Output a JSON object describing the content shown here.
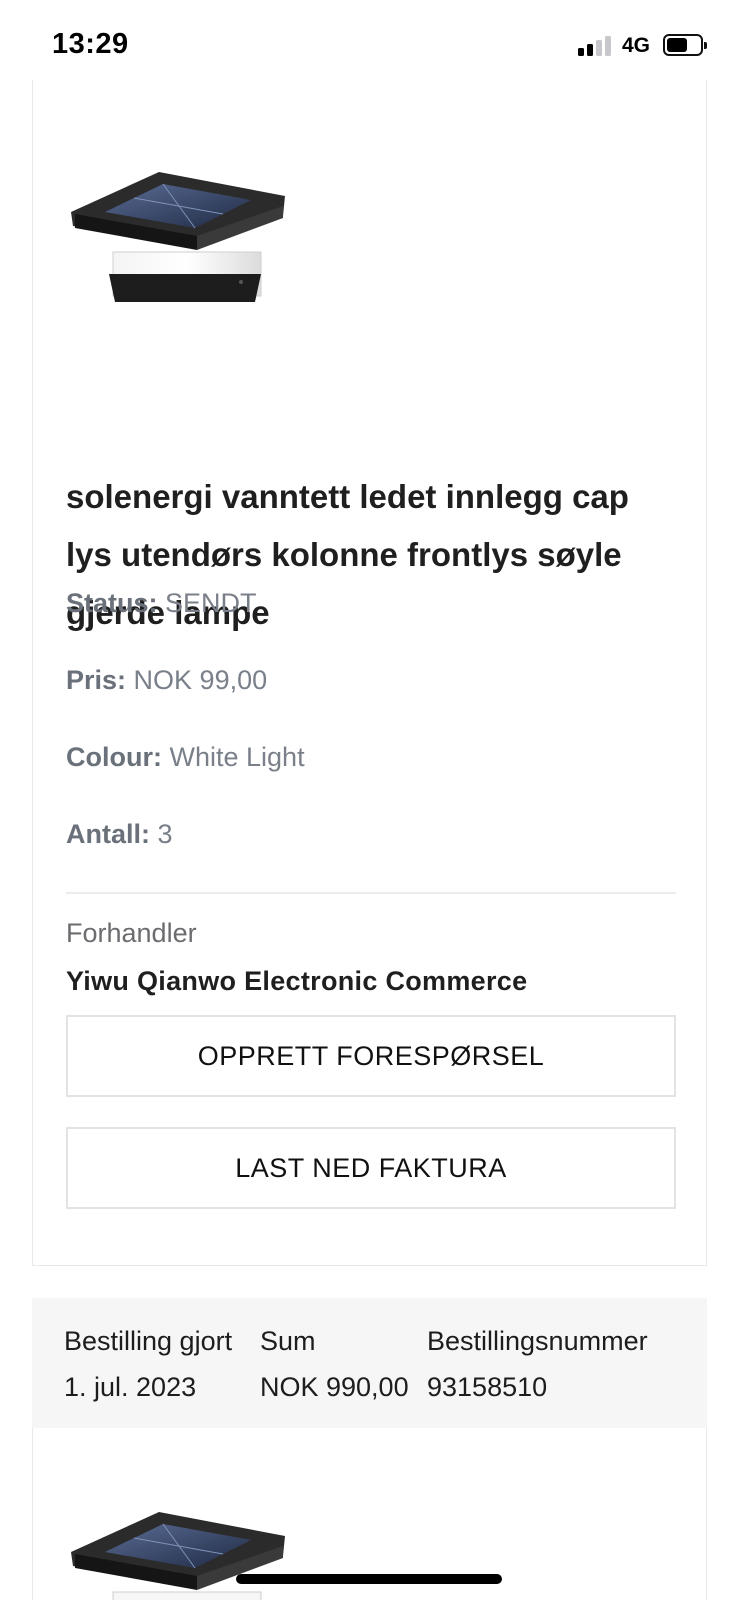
{
  "status_bar": {
    "time": "13:29",
    "network": "4G",
    "signal_bars_active": 2,
    "signal_bars_total": 4,
    "battery_level": 0.5
  },
  "order_item": {
    "image_icon": "solar-post-cap-light-image",
    "title": "solenergi vanntett ledet innlegg cap lys utendørs kolonne frontlys søyle gjerde lampe",
    "status_label": "Status:",
    "status_value": "SENDT",
    "price_label": "Pris:",
    "price_value": "NOK 99,00",
    "colour_label": "Colour:",
    "colour_value": "White Light",
    "quantity_label": "Antall:",
    "quantity_value": "3",
    "dealer_label": "Forhandler",
    "dealer_name": "Yiwu Qianwo Electronic Commerce",
    "create_request_label": "OPPRETT FORESPØRSEL",
    "download_invoice_label": "LAST NED FAKTURA"
  },
  "next_order": {
    "ordered_label": "Bestilling gjort",
    "ordered_value": "1. jul. 2023",
    "sum_label": "Sum",
    "sum_value": "NOK 990,00",
    "order_number_label": "Bestillingsnummer",
    "order_number_value": "93158510",
    "image_icon": "solar-post-cap-light-image"
  },
  "colors": {
    "text_dark": "#1f1f1f",
    "label_gray": "#6b717a",
    "border": "#e3e3e3",
    "summary_bg": "#f6f6f6"
  }
}
